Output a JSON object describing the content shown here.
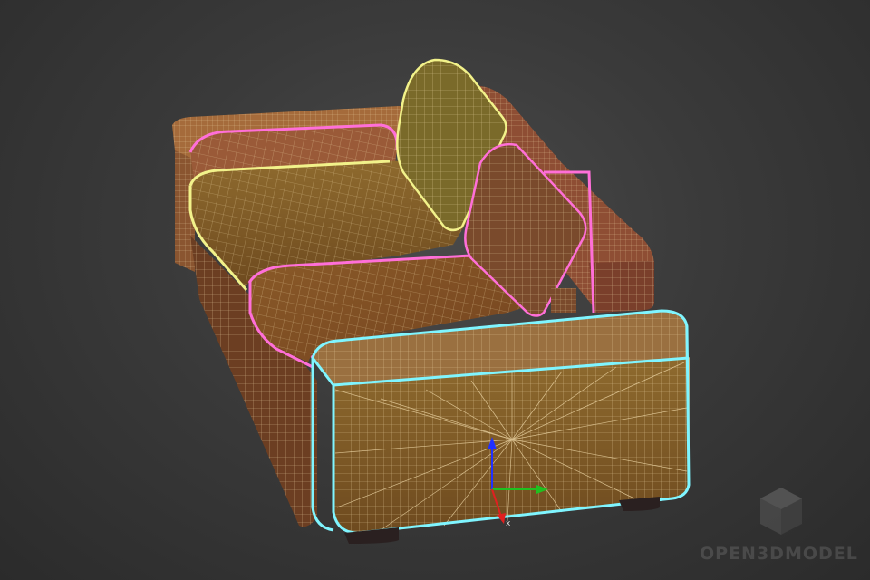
{
  "watermark": {
    "text": "OPEN3DMODEL",
    "logo_icon": "cube-logo-icon"
  },
  "gizmo": {
    "axis_x_label": "x"
  },
  "colors": {
    "background": "#333333",
    "surface": "#8a5a2a",
    "wire_light": "#e8c98a",
    "wire_pink": "#ff6fd8",
    "wire_yellow": "#f2f28a",
    "wire_cyan": "#7ff5ff",
    "axis_x": "#e02020",
    "axis_y": "#20c020",
    "axis_z": "#2030ff"
  }
}
